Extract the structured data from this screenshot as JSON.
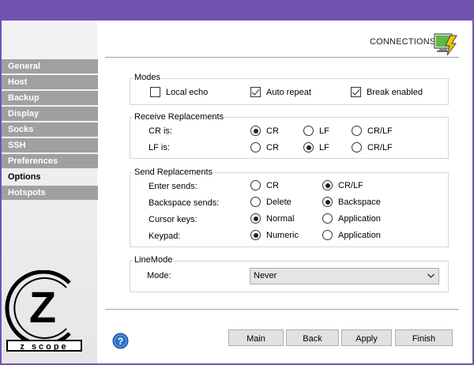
{
  "header": {
    "title": "CONNECTIONS",
    "icon": "connections-icon"
  },
  "sidebar": {
    "items": [
      {
        "label": "General"
      },
      {
        "label": "Host"
      },
      {
        "label": "Backup"
      },
      {
        "label": "Display"
      },
      {
        "label": "Socks"
      },
      {
        "label": "SSH"
      },
      {
        "label": "Preferences"
      },
      {
        "label": "Options",
        "active": true
      },
      {
        "label": "Hotspots"
      }
    ]
  },
  "logo": {
    "letter": "Z",
    "wordmark": "z scope"
  },
  "modes": {
    "title": "Modes",
    "local_echo": {
      "label": "Local echo",
      "checked": false
    },
    "auto_repeat": {
      "label": "Auto repeat",
      "checked": true
    },
    "break_enabled": {
      "label": "Break enabled",
      "checked": true
    }
  },
  "receive": {
    "title": "Receive Replacements",
    "cr_label": "CR is:",
    "lf_label": "LF is:",
    "options": [
      "CR",
      "LF",
      "CR/LF"
    ],
    "cr_selected": "CR",
    "lf_selected": "LF"
  },
  "send": {
    "title": "Send Replacements",
    "enter": {
      "label": "Enter sends:",
      "opt1": "CR",
      "opt2": "CR/LF",
      "selected": "CR/LF"
    },
    "backspace": {
      "label": "Backspace sends:",
      "opt1": "Delete",
      "opt2": "Backspace",
      "selected": "Backspace"
    },
    "cursor": {
      "label": "Cursor keys:",
      "opt1": "Normal",
      "opt2": "Application",
      "selected": "Normal"
    },
    "keypad": {
      "label": "Keypad:",
      "opt1": "Numeric",
      "opt2": "Application",
      "selected": "Numeric"
    }
  },
  "linemode": {
    "title": "LineMode",
    "mode_label": "Mode:",
    "mode_value": "Never"
  },
  "buttons": {
    "main": "Main",
    "back": "Back",
    "apply": "Apply",
    "finish": "Finish"
  },
  "colors": {
    "titlebar": "#7152b1",
    "nav_bg": "#a0a0a0",
    "help_blue": "#2f6fc9"
  }
}
